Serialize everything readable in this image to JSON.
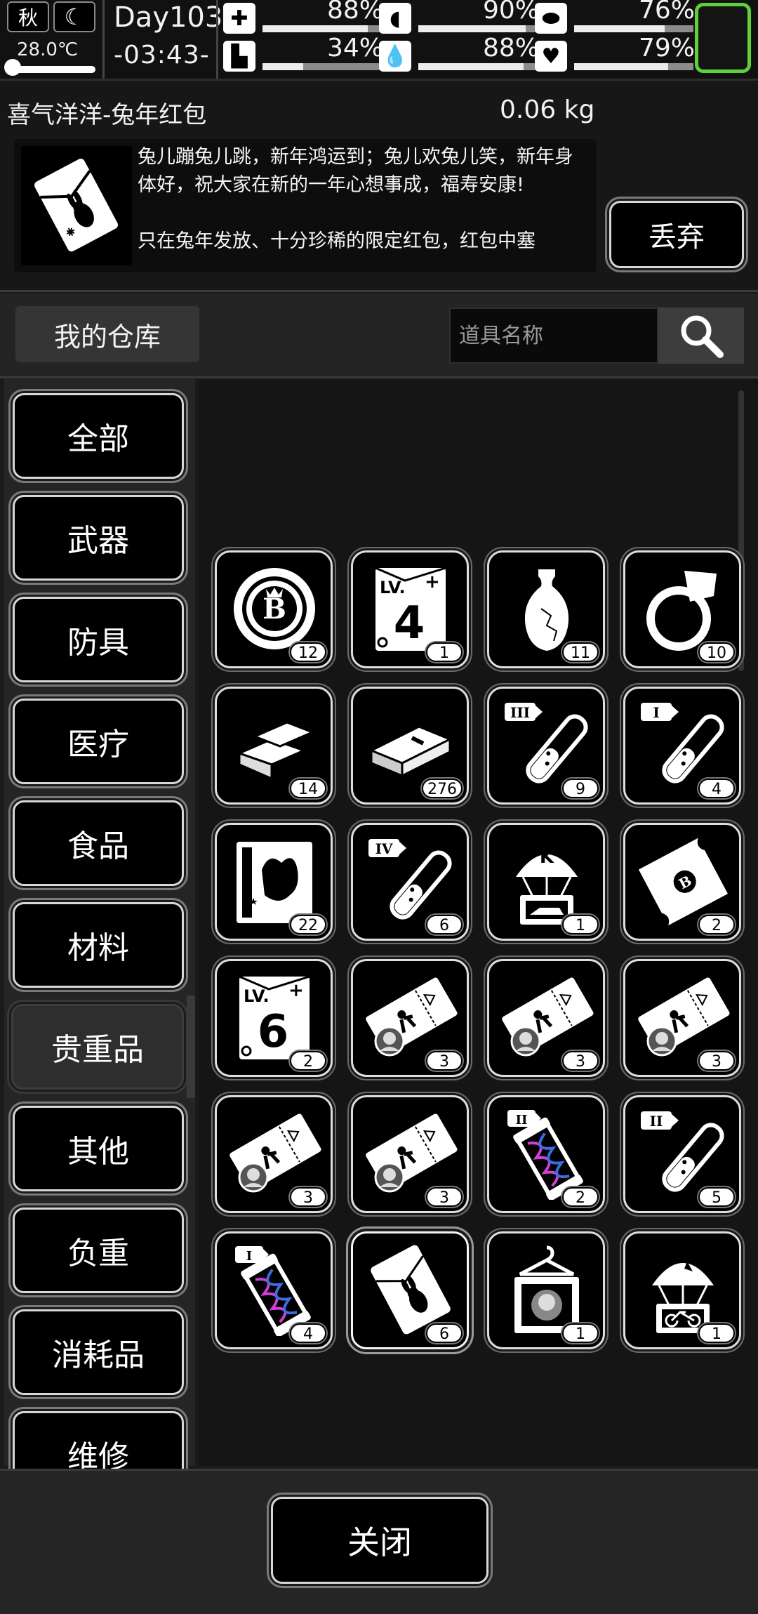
{
  "status": {
    "season": "秋",
    "temperature": "28.0℃",
    "day": "Day103",
    "time": "-03:43-",
    "stats": [
      {
        "icon": "medkit-icon",
        "glyph": "✚",
        "value": "88%",
        "level": 0.88
      },
      {
        "icon": "stomach-icon",
        "glyph": "◖",
        "value": "90%",
        "level": 0.9
      },
      {
        "icon": "pill-icon",
        "glyph": "⬬",
        "value": "76%",
        "level": 0.76
      },
      {
        "icon": "foot-icon",
        "glyph": "▙",
        "value": "34%",
        "level": 0.34
      },
      {
        "icon": "water-drop-icon",
        "glyph": "💧",
        "value": "88%",
        "level": 0.88
      },
      {
        "icon": "heart-icon",
        "glyph": "♥",
        "value": "79%",
        "level": 0.79
      }
    ]
  },
  "detail": {
    "name": "喜气洋洋-兔年红包",
    "weight": "0.06 kg",
    "description": "兔儿蹦兔儿跳，新年鸿运到；兔儿欢兔儿笑，新年身体好，祝大家在新的一年心想事成，福寿安康!\n\n只在兔年发放、十分珍稀的限定红包，红包中塞",
    "discard_label": "丢弃"
  },
  "warehouse": {
    "title": "我的仓库",
    "search_placeholder": "道具名称"
  },
  "categories": [
    "全部",
    "武器",
    "防具",
    "医疗",
    "食品",
    "材料",
    "贵重品",
    "其他",
    "负重",
    "消耗品",
    "维修"
  ],
  "active_category": "贵重品",
  "items": [
    {
      "icon": "bitcoin-chip-icon",
      "qty": "12"
    },
    {
      "icon": "level-4-card-icon",
      "qty": "1"
    },
    {
      "icon": "vase-icon",
      "qty": "11"
    },
    {
      "icon": "ring-icon",
      "qty": "10"
    },
    {
      "icon": "gold-bars-icon",
      "qty": "14"
    },
    {
      "icon": "cash-bundle-icon",
      "qty": "276"
    },
    {
      "icon": "test-tube-3-icon",
      "qty": "9"
    },
    {
      "icon": "test-tube-1-icon",
      "qty": "4"
    },
    {
      "icon": "film-poster-icon",
      "qty": "22"
    },
    {
      "icon": "test-tube-4-icon",
      "qty": "6"
    },
    {
      "icon": "airdrop-k-car-icon",
      "qty": "1"
    },
    {
      "icon": "scroll-icon",
      "qty": "2"
    },
    {
      "icon": "level-6-card-icon",
      "qty": "2"
    },
    {
      "icon": "ticket-icon",
      "qty": "3"
    },
    {
      "icon": "ticket-icon",
      "qty": "3"
    },
    {
      "icon": "ticket-icon",
      "qty": "3"
    },
    {
      "icon": "ticket-icon",
      "qty": "3"
    },
    {
      "icon": "ticket-icon",
      "qty": "3"
    },
    {
      "icon": "dna-capsule-2-icon",
      "qty": "2"
    },
    {
      "icon": "test-tube-2-icon",
      "qty": "5"
    },
    {
      "icon": "dna-capsule-1-icon",
      "qty": "4"
    },
    {
      "icon": "rabbit-red-envelope-icon",
      "qty": "6"
    },
    {
      "icon": "clothes-hanger-box-icon",
      "qty": "1"
    },
    {
      "icon": "airdrop-bicycle-icon",
      "qty": "1"
    }
  ],
  "icon_text": {
    "level4": "LV.",
    "level4_num": "4",
    "level6": "LV.",
    "level6_num": "6",
    "tube_3": "III",
    "tube_1": "I",
    "tube_4": "IV",
    "tube_2": "II",
    "capsule_2": "II",
    "capsule_1": "I",
    "airdrop_k": "K",
    "coin": "B"
  },
  "close_label": "关闭",
  "colors": {
    "accent_green": "#5fd13b",
    "panel": "#151515",
    "slot_border": "#dedede"
  }
}
